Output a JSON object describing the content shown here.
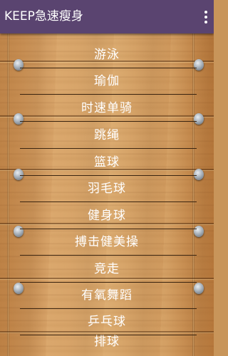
{
  "app_bar": {
    "title": "KEEP急速瘦身",
    "overflow_icon": "more-vert-icon",
    "background_color": "#5a4470",
    "text_color": "#ffffff"
  },
  "background": {
    "style": "wood planks",
    "base_color": "#d09a5e",
    "nail_icon": "nail-icon"
  },
  "menu": {
    "items": [
      {
        "label": "游泳"
      },
      {
        "label": "瑜伽"
      },
      {
        "label": "时速单骑"
      },
      {
        "label": "跳绳"
      },
      {
        "label": "篮球"
      },
      {
        "label": "羽毛球"
      },
      {
        "label": "健身球"
      },
      {
        "label": "搏击健美操"
      },
      {
        "label": "竞走"
      },
      {
        "label": "有氧舞蹈"
      },
      {
        "label": "乒乓球"
      },
      {
        "label": "排球"
      }
    ]
  }
}
